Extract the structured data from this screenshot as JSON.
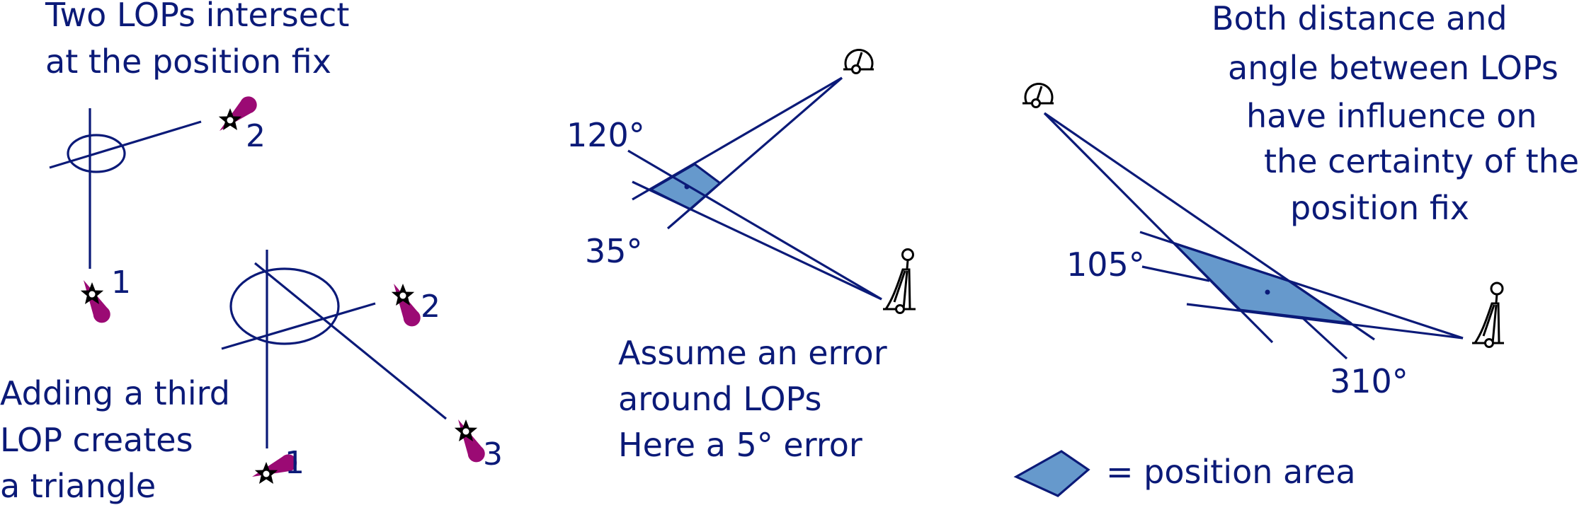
{
  "colors": {
    "line": "#0b1a78",
    "text": "#0b1a78",
    "position_area": "#6699cc",
    "bearing_drop": "#9b0a74",
    "star": "#000000"
  },
  "panel_two_lops": {
    "caption_lines": [
      "Two LOPs intersect",
      "at the position fix"
    ],
    "star_labels": [
      "1",
      "2"
    ]
  },
  "panel_three_lops": {
    "caption_lines": [
      "Adding a third",
      "LOP creates",
      "a triangle"
    ],
    "star_labels": [
      "1",
      "2",
      "3"
    ]
  },
  "panel_error": {
    "caption_lines": [
      "Assume an error",
      "around LOPs",
      "Here a 5° error"
    ],
    "bearing_labels": [
      "120°",
      "35°"
    ],
    "error_degrees": 5
  },
  "panel_distance_angle": {
    "caption_lines": [
      "Both distance and",
      "angle between LOPs",
      "have influence on",
      "the certainty of the",
      "position fix"
    ],
    "bearing_labels": [
      "105°",
      "310°"
    ]
  },
  "legend": {
    "label": "= position area"
  },
  "icons": {
    "landmark": "star-landmark-icon",
    "bearing_indicator": "teardrop-bearing-icon",
    "radar_beacon": "radar-beacon-icon",
    "lighthouse": "lighthouse-icon"
  }
}
